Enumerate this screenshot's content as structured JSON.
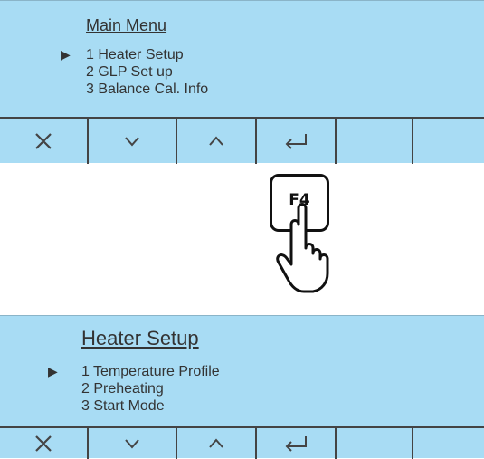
{
  "main_menu": {
    "title": "Main Menu",
    "items": [
      "1 Heater Setup",
      "2 GLP Set up",
      "3 Balance Cal. Info"
    ],
    "selected_index": 0
  },
  "heater_setup": {
    "title": "Heater Setup",
    "items": [
      "1 Temperature Profile",
      "2 Preheating",
      "3 Start Mode"
    ],
    "selected_index": 0
  },
  "softkeys": [
    "close-icon",
    "chevron-down-icon",
    "chevron-up-icon",
    "enter-icon",
    "",
    ""
  ],
  "pressed_key": {
    "label": "F4"
  },
  "colors": {
    "lcd_background": "#a8dcf4",
    "text": "#333333",
    "line": "#444444"
  }
}
